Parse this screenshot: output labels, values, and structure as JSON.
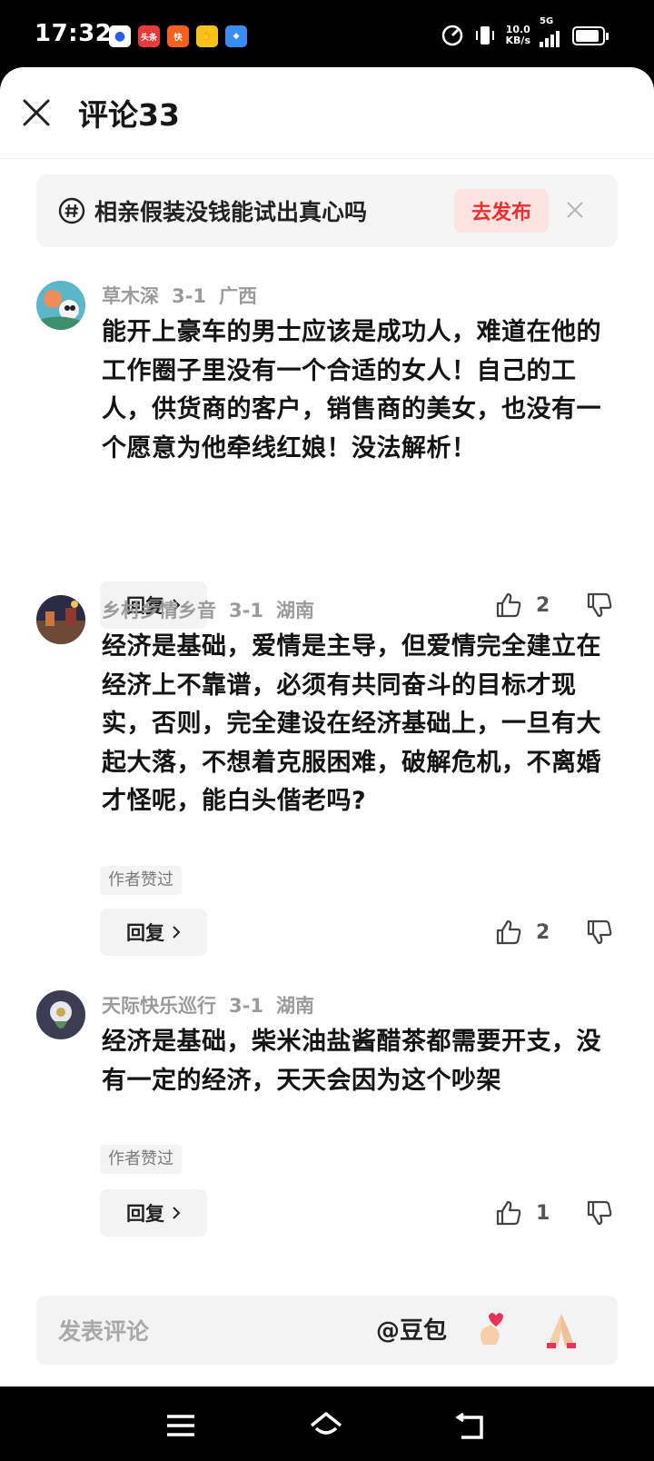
{
  "status_bar": {
    "time": "17:32",
    "notification_labels": [
      "头条",
      "快"
    ],
    "net_speed_value": "10.0",
    "net_speed_unit": "KB/s",
    "network": "5G"
  },
  "header": {
    "title": "评论33"
  },
  "topic": {
    "text": "相亲假装没钱能试出真心吗",
    "publish_label": "去发布"
  },
  "comments": [
    {
      "user": "草木深",
      "date": "3-1",
      "location": "广西",
      "text": "能开上豪车的男士应该是成功人，难道在他的工作圈子里没有一个合适的女人！自己的工人，供货商的客户，销售商的美女，也没有一个愿意为他牵线红娘！没法解析！",
      "author_liked": "",
      "reply_label": "回复",
      "likes": "2"
    },
    {
      "user": "乡村乡情乡音",
      "date": "3-1",
      "location": "湖南",
      "text": "经济是基础，爱情是主导，但爱情完全建立在经济上不靠谱，必须有共同奋斗的目标才现实，否则，完全建设在经济基础上，一旦有大起大落，不想着克服困难，破解危机，不离婚才怪呢，能白头偕老吗?",
      "author_liked": "作者赞过",
      "reply_label": "回复",
      "likes": "2"
    },
    {
      "user": "天际快乐巡行",
      "date": "3-1",
      "location": "湖南",
      "text": "经济是基础，柴米油盐酱醋茶都需要开支，没有一定的经济，天天会因为这个吵架",
      "author_liked": "作者赞过",
      "reply_label": "回复",
      "likes": "1"
    }
  ],
  "input_bar": {
    "placeholder": "发表评论",
    "mention": "@豆包",
    "emojis": [
      "finger-heart-emoji",
      "folded-hands-emoji"
    ]
  },
  "colors": {
    "accent": "#e9302f",
    "accent_bg": "#fde2e2",
    "meta": "#9b9b9b",
    "text": "#141414"
  }
}
